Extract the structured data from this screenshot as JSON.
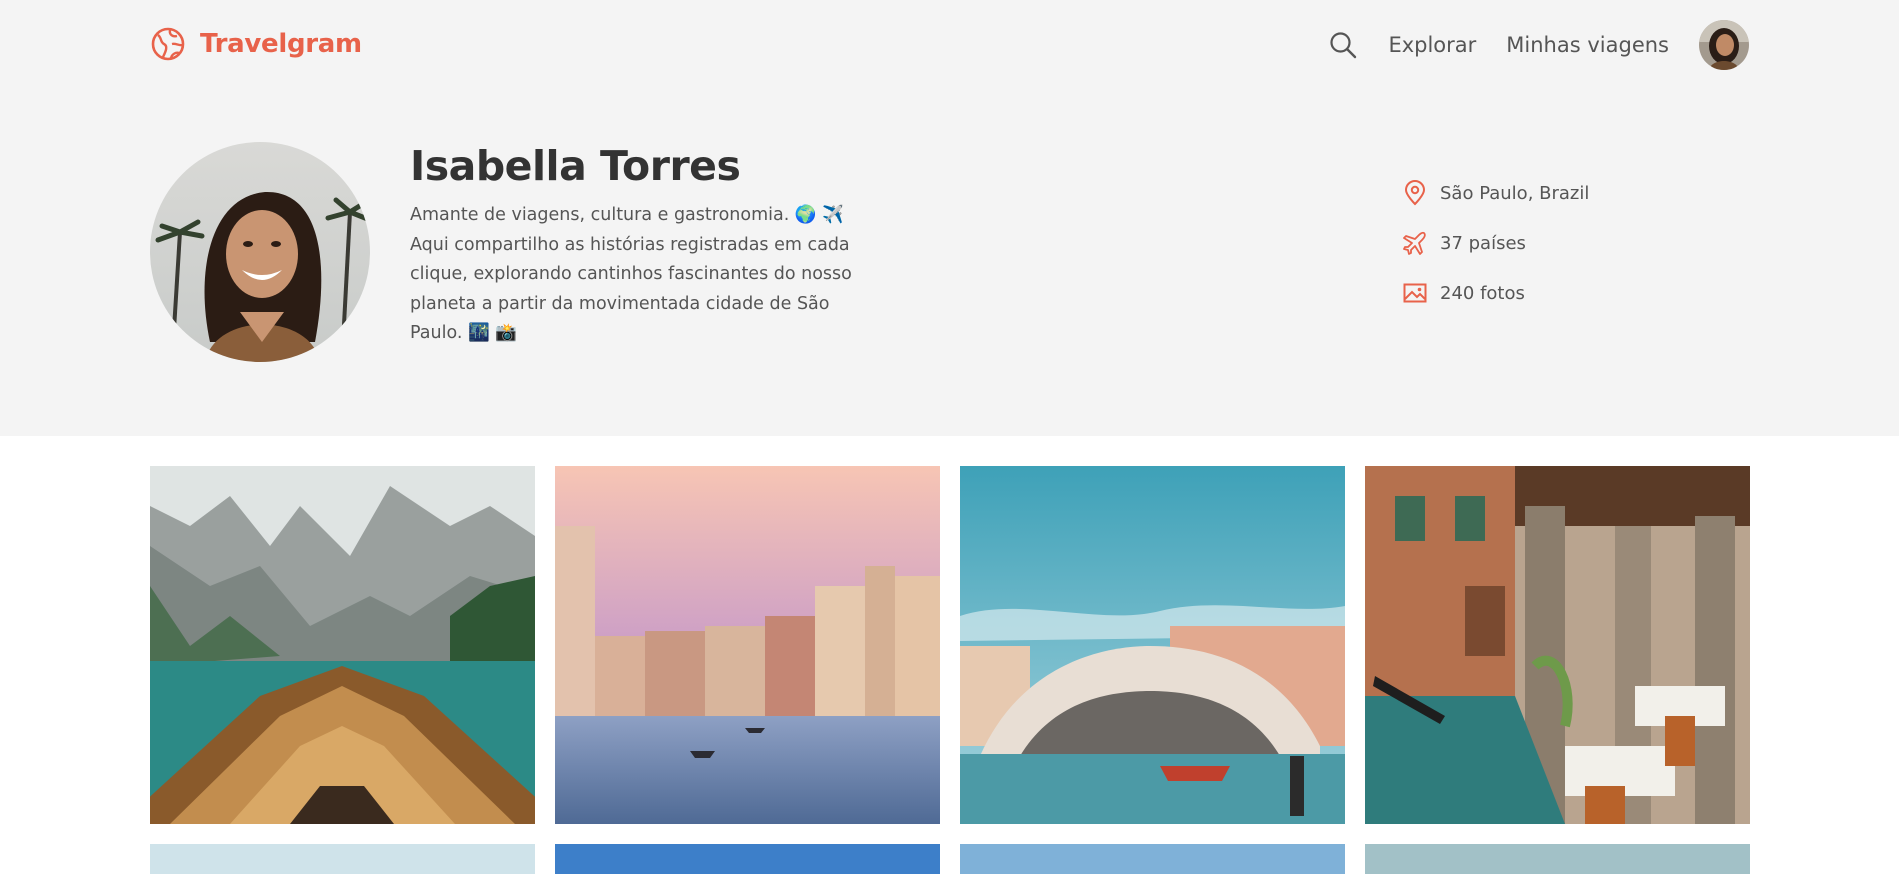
{
  "brand": {
    "name": "Travelgram",
    "icon": "globe-icon",
    "accent": "#e8624a"
  },
  "nav": {
    "search_icon": "search-icon",
    "links": [
      {
        "label": "Explorar"
      },
      {
        "label": "Minhas viagens"
      }
    ]
  },
  "profile": {
    "name": "Isabella Torres",
    "bio": "Amante de viagens, cultura e gastronomia. 🌍 ✈️ Aqui compartilho as histórias registradas em cada clique, explorando cantinhos fascinantes do nosso planeta a partir da movimentada cidade de São Paulo. 🌃 📸",
    "stats": [
      {
        "icon": "location-pin-icon",
        "text": "São Paulo, Brazil"
      },
      {
        "icon": "airplane-icon",
        "text": "37 países"
      },
      {
        "icon": "image-icon",
        "text": "240 fotos"
      }
    ]
  },
  "gallery": {
    "photos": [
      {
        "name": "mountain-lake-boat-photo"
      },
      {
        "name": "venice-canal-sunset-photo"
      },
      {
        "name": "rialto-bridge-photo"
      },
      {
        "name": "venice-cafe-terrace-photo"
      }
    ]
  }
}
